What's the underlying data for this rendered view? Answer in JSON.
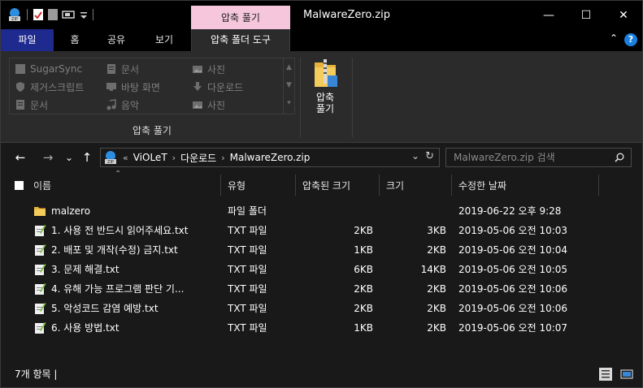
{
  "window": {
    "title": "MalwareZero.zip",
    "context_tab": "압축 풀기",
    "minimize": "—",
    "maximize": "☐",
    "close": "✕"
  },
  "ribbon_tabs": {
    "file": "파일",
    "home": "홈",
    "share": "공유",
    "view": "보기",
    "compressed_tools": "압축 폴더 도구",
    "collapse": "⌃",
    "help": "?"
  },
  "ribbon": {
    "gallery": [
      {
        "label": "SugarSync",
        "icon": "sugarsync-icon"
      },
      {
        "label": "문서",
        "icon": "document-icon"
      },
      {
        "label": "사진",
        "icon": "picture-icon"
      },
      {
        "label": "제거스크립트",
        "icon": "shield-icon"
      },
      {
        "label": "바탕 화면",
        "icon": "desktop-icon"
      },
      {
        "label": "다운로드",
        "icon": "download-icon"
      },
      {
        "label": "문서",
        "icon": "document-icon"
      },
      {
        "label": "음악",
        "icon": "music-icon"
      },
      {
        "label": "사진",
        "icon": "picture-icon"
      }
    ],
    "group_label": "압축 풀기",
    "extract_all_line1": "압축",
    "extract_all_line2": "풀기"
  },
  "navigation": {
    "back": "←",
    "forward": "→",
    "recent": "⌄",
    "up": "↑",
    "overflow": "«",
    "breadcrumbs": [
      "ViOLeT",
      "다운로드",
      "MalwareZero.zip"
    ],
    "dropdown": "⌄",
    "refresh": "↻"
  },
  "search": {
    "placeholder": "MalwareZero.zip 검색",
    "icon": "search-icon"
  },
  "columns": {
    "name": "이름",
    "type": "유형",
    "compressed_size": "압축된 크기",
    "size": "크기",
    "date_modified": "수정한 날짜"
  },
  "files": [
    {
      "name": "malzero",
      "type": "파일 폴더",
      "compressed": "",
      "size": "",
      "date": "2019-06-22 오후 9:28",
      "icon": "folder-icon"
    },
    {
      "name": "1. 사용 전 반드시 읽어주세요.txt",
      "type": "TXT 파일",
      "compressed": "2KB",
      "size": "3KB",
      "date": "2019-05-06 오전 10:03",
      "icon": "text-file-icon"
    },
    {
      "name": "2. 배포 및 개작(수정) 금지.txt",
      "type": "TXT 파일",
      "compressed": "1KB",
      "size": "2KB",
      "date": "2019-05-06 오전 10:04",
      "icon": "text-file-icon"
    },
    {
      "name": "3. 문제 해결.txt",
      "type": "TXT 파일",
      "compressed": "6KB",
      "size": "14KB",
      "date": "2019-05-06 오전 10:05",
      "icon": "text-file-icon"
    },
    {
      "name": "4. 유해 가능 프로그램 판단 기...",
      "type": "TXT 파일",
      "compressed": "2KB",
      "size": "2KB",
      "date": "2019-05-06 오전 10:06",
      "icon": "text-file-icon"
    },
    {
      "name": "5. 악성코드 감염 예방.txt",
      "type": "TXT 파일",
      "compressed": "2KB",
      "size": "2KB",
      "date": "2019-05-06 오전 10:06",
      "icon": "text-file-icon"
    },
    {
      "name": "6. 사용 방법.txt",
      "type": "TXT 파일",
      "compressed": "1KB",
      "size": "2KB",
      "date": "2019-05-06 오전 10:07",
      "icon": "text-file-icon"
    }
  ],
  "status": {
    "item_count": "7개 항목  |"
  },
  "colors": {
    "background": "#191919",
    "titlebar": "#000000",
    "file_tab": "#1f2a8f",
    "context_tab": "#f5c6dc",
    "ribbon": "#2b2b2b",
    "folder": "#f2c14e",
    "help": "#1a7fe0"
  }
}
